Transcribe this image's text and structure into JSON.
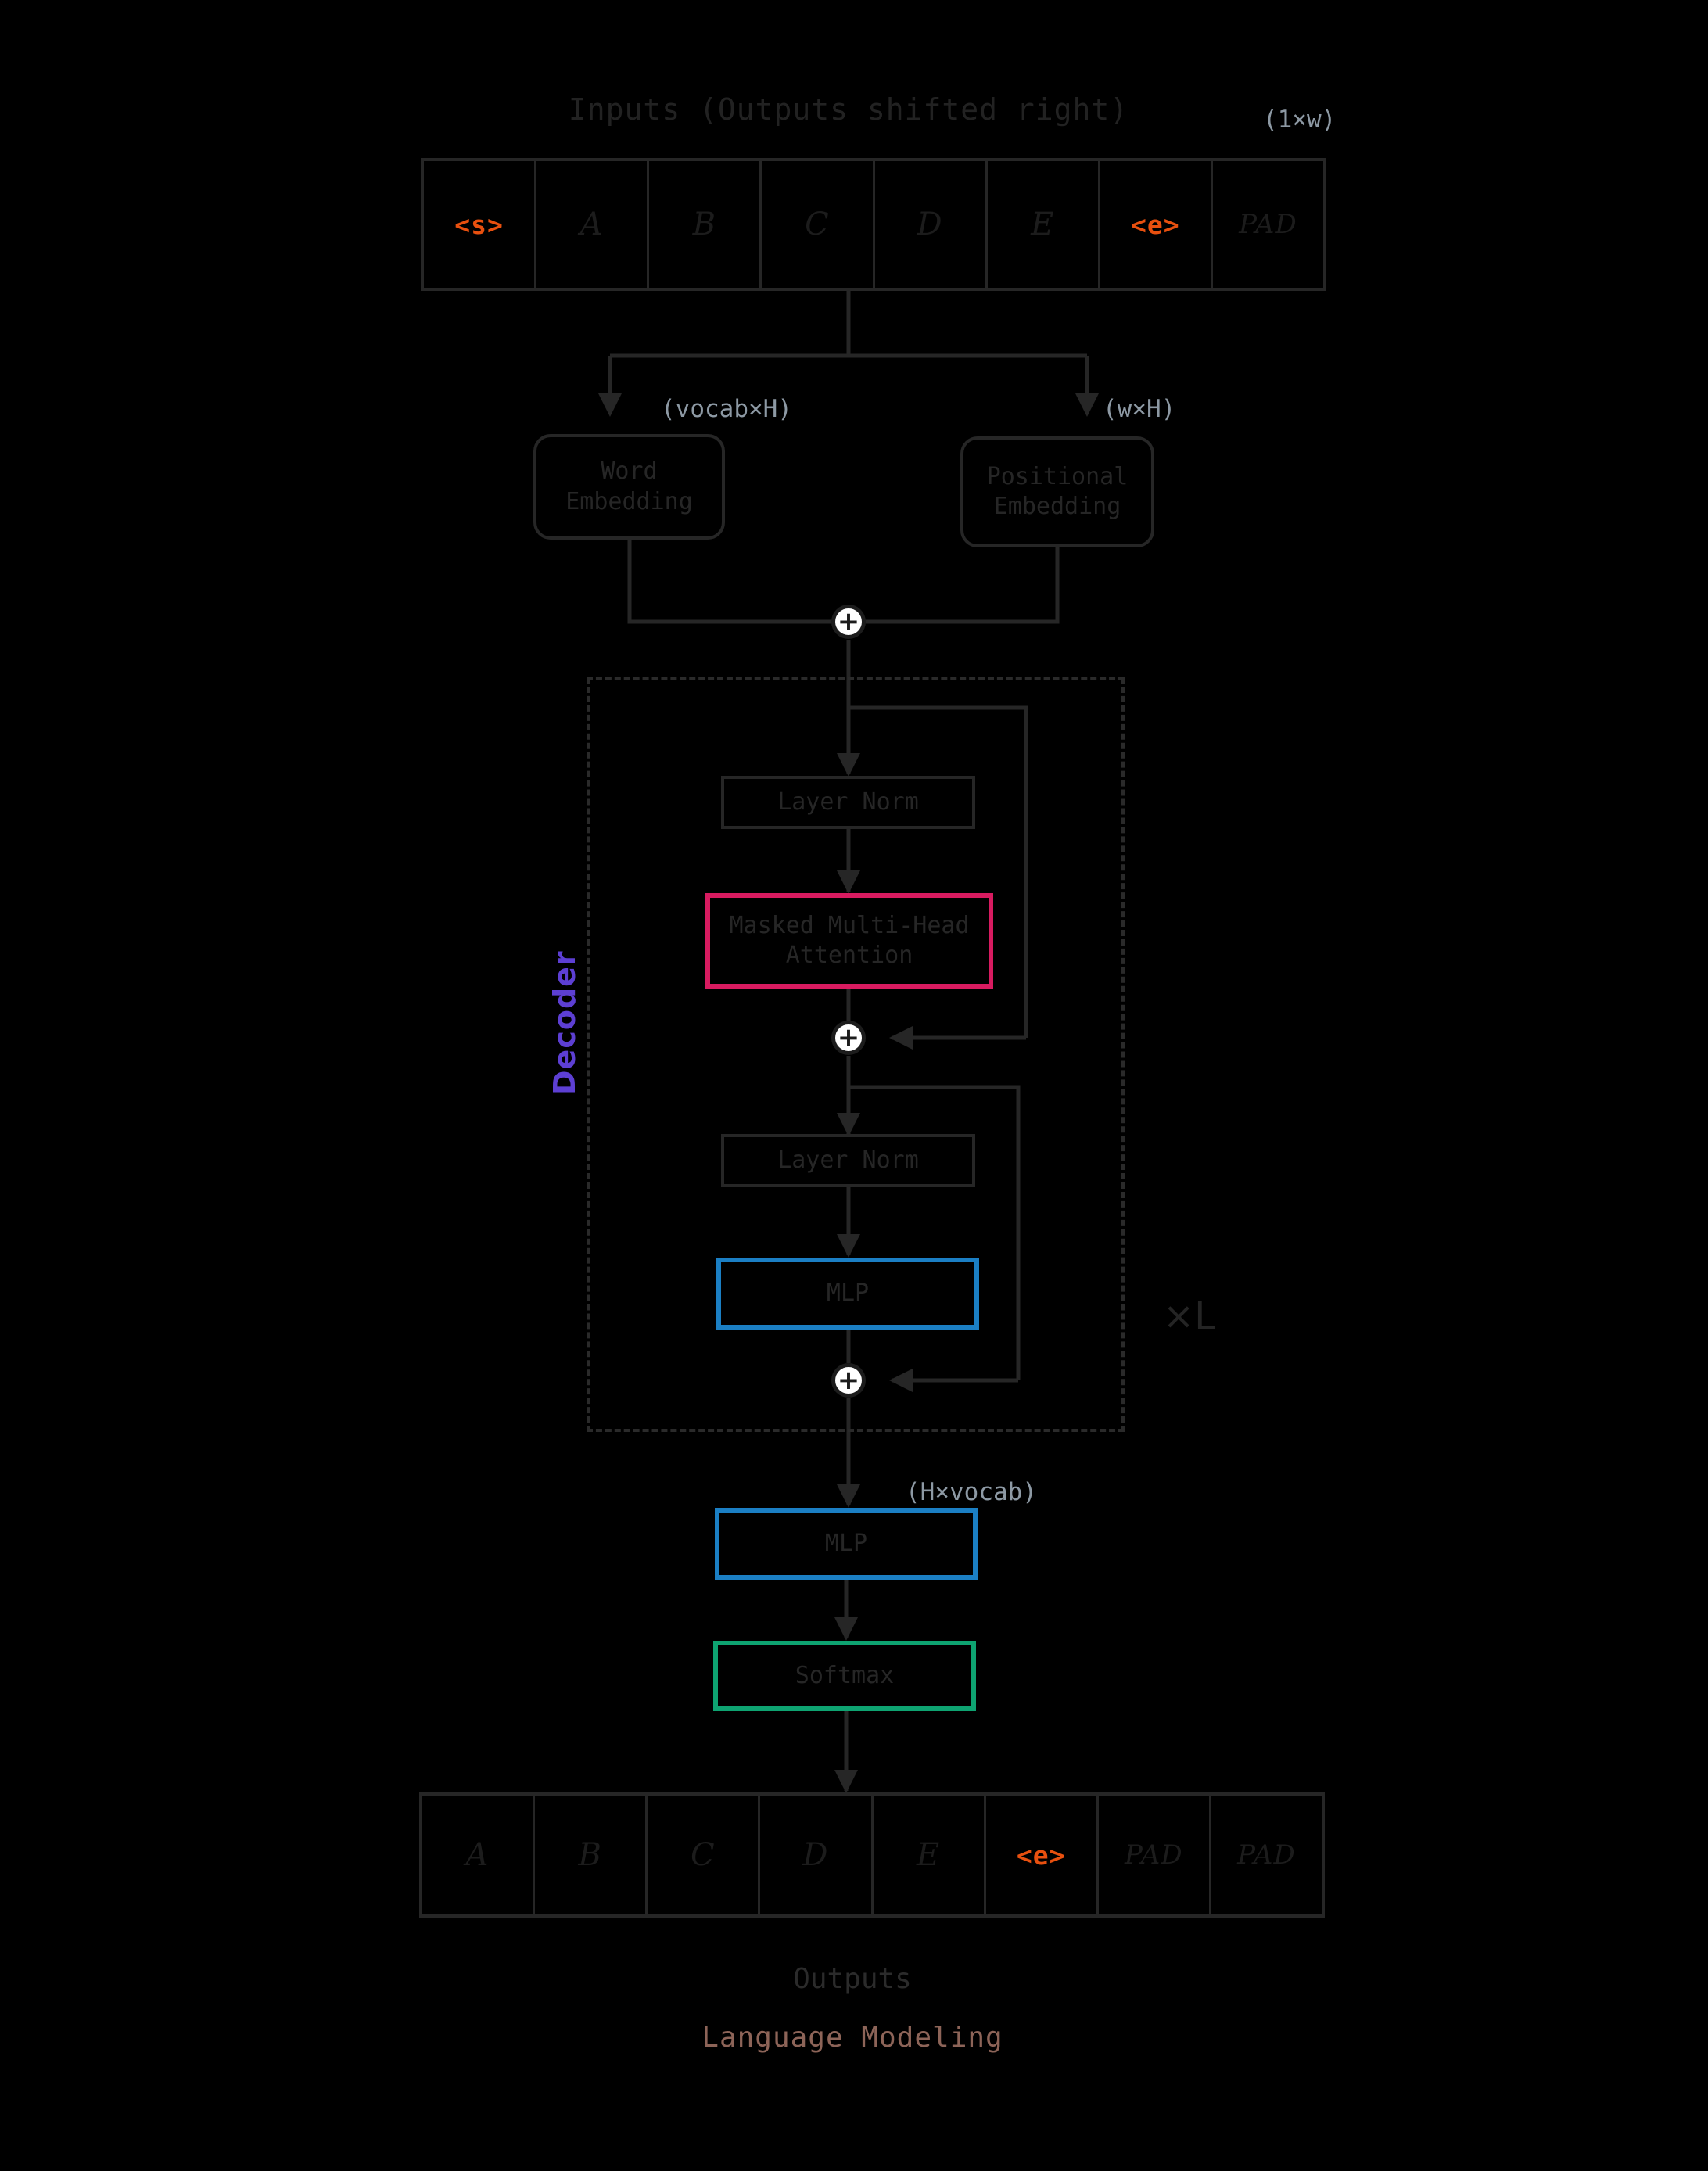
{
  "meta": {
    "background": "#000000",
    "accents": {
      "attention": "#d81b60",
      "mlp": "#1b7fc4",
      "softmax": "#0ea371",
      "decoder_label": "#5d3fd3",
      "special_token": "#e8500f",
      "dimension_label": "#8d99a4",
      "caption": "#8d6458",
      "line": "#262626"
    }
  },
  "header": {
    "title": "Inputs (Outputs shifted right)",
    "input_shape_label": "(1×w)"
  },
  "input_tokens": [
    {
      "text": "<s>",
      "kind": "special"
    },
    {
      "text": "A",
      "kind": "letter"
    },
    {
      "text": "B",
      "kind": "letter"
    },
    {
      "text": "C",
      "kind": "letter"
    },
    {
      "text": "D",
      "kind": "letter"
    },
    {
      "text": "E",
      "kind": "letter"
    },
    {
      "text": "<e>",
      "kind": "special"
    },
    {
      "text": "PAD",
      "kind": "pad"
    }
  ],
  "embeddings": {
    "word": {
      "label": "Word\nEmbedding",
      "shape_label": "(vocab×H)"
    },
    "positional": {
      "label": "Positional\nEmbedding",
      "shape_label": "(w×H)"
    },
    "sum_symbol": "+"
  },
  "decoder": {
    "label": "Decoder",
    "repeat_label": "×L",
    "blocks": [
      {
        "id": "ln1",
        "label": "Layer Norm",
        "accent": "none"
      },
      {
        "id": "attn",
        "label": "Masked Multi-Head\nAttention",
        "accent": "pink"
      },
      {
        "id": "add1",
        "label": "+",
        "accent": "none"
      },
      {
        "id": "ln2",
        "label": "Layer Norm",
        "accent": "none"
      },
      {
        "id": "mlp",
        "label": "MLP",
        "accent": "blue"
      },
      {
        "id": "add2",
        "label": "+",
        "accent": "none"
      }
    ]
  },
  "head": {
    "mlp": {
      "label": "MLP",
      "shape_label": "(H×vocab)"
    },
    "softmax": {
      "label": "Softmax"
    }
  },
  "output_tokens": [
    {
      "text": "A",
      "kind": "letter"
    },
    {
      "text": "B",
      "kind": "letter"
    },
    {
      "text": "C",
      "kind": "letter"
    },
    {
      "text": "D",
      "kind": "letter"
    },
    {
      "text": "E",
      "kind": "letter"
    },
    {
      "text": "<e>",
      "kind": "special"
    },
    {
      "text": "PAD",
      "kind": "pad"
    },
    {
      "text": "PAD",
      "kind": "pad"
    }
  ],
  "footer": {
    "outputs_label": "Outputs",
    "caption": "Language Modeling"
  }
}
